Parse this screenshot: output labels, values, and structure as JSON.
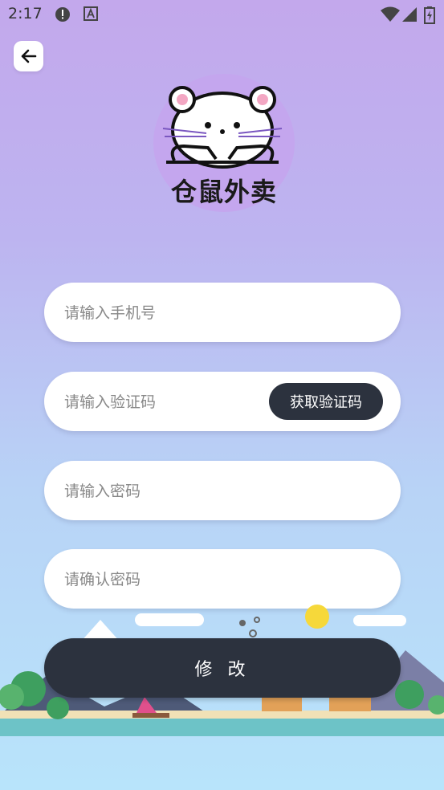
{
  "status_bar": {
    "time": "2:17",
    "icons": [
      "alert-icon",
      "a-icon",
      "wifi-icon",
      "signal-icon",
      "battery-icon"
    ]
  },
  "header": {
    "back_icon": "arrow-left-icon"
  },
  "logo": {
    "text": "仓鼠外卖",
    "bg_color": "#c4a6ee"
  },
  "form": {
    "phone_placeholder": "请输入手机号",
    "code_placeholder": "请输入验证码",
    "get_code_label": "获取验证码",
    "password_placeholder": "请输入密码",
    "confirm_placeholder": "请确认密码",
    "submit_label": "修 改"
  },
  "colors": {
    "primary_dark": "#2c323e",
    "bg_top": "#c3a8ec",
    "bg_bottom": "#b8e4fb"
  }
}
